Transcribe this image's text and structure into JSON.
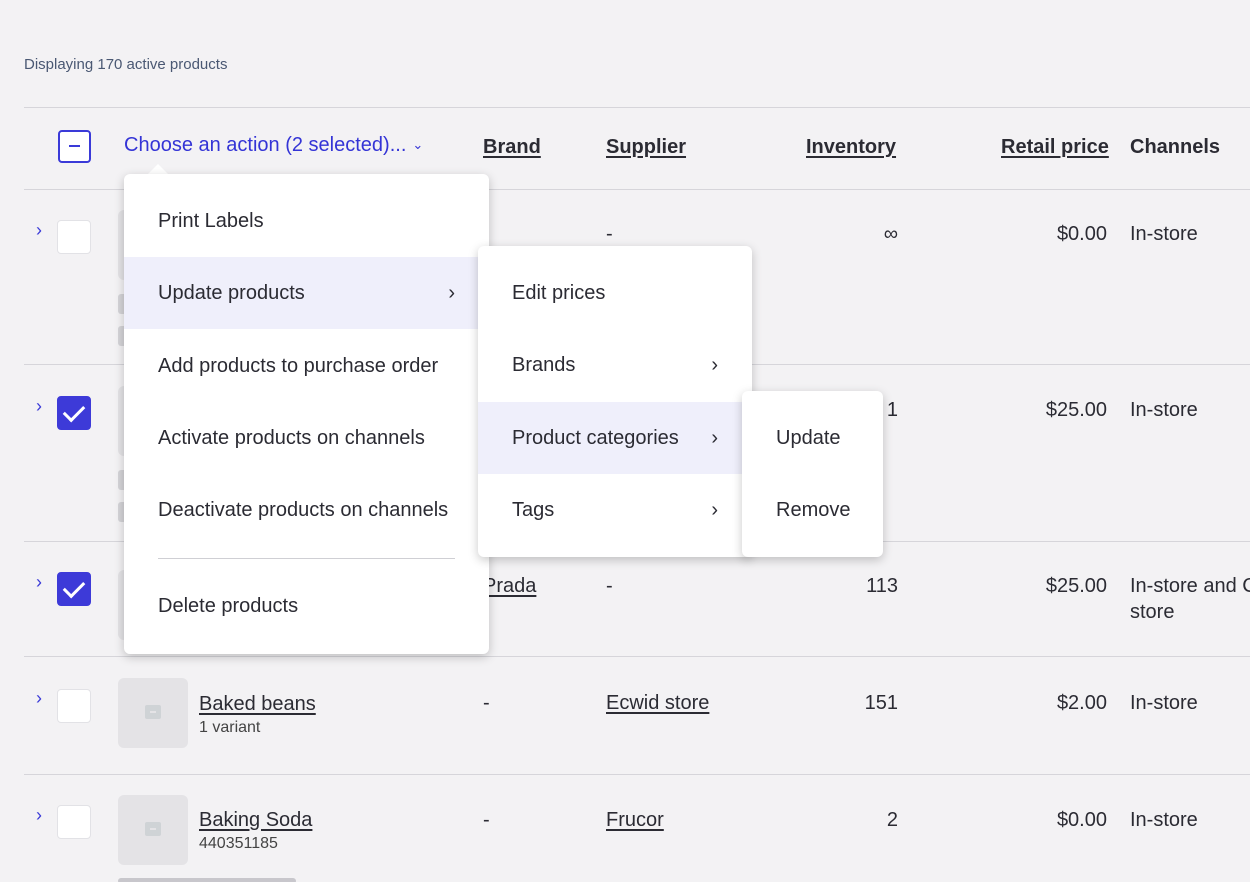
{
  "summary": "Displaying 170 active products",
  "header": {
    "action_label": "Choose an action (2 selected)...",
    "brand": "Brand",
    "supplier": "Supplier",
    "inventory": "Inventory",
    "retail_price": "Retail price",
    "channels": "Channels"
  },
  "rows": [
    {
      "name": "",
      "sub": "",
      "brand": "-",
      "supplier": "-",
      "inventory": "∞",
      "price": "$0.00",
      "channels": "In-store",
      "checked": false
    },
    {
      "name": "",
      "sub": "",
      "brand": "",
      "supplier": "",
      "inventory": "1",
      "price": "$25.00",
      "channels": "In-store",
      "checked": true
    },
    {
      "name": "",
      "sub": "",
      "brand": "Prada",
      "supplier": "-",
      "inventory": "113",
      "price": "$25.00",
      "channels": "In-store and C",
      "channels_line2": "store",
      "checked": true
    },
    {
      "name": "Baked beans",
      "sub": "1 variant",
      "brand": "-",
      "supplier": "Ecwid store",
      "inventory": "151",
      "price": "$2.00",
      "channels": "In-store",
      "checked": false
    },
    {
      "name": "Baking Soda",
      "sub": "440351185",
      "brand": "-",
      "supplier": "Frucor",
      "inventory": "2",
      "price": "$0.00",
      "channels": "In-store",
      "checked": false
    }
  ],
  "action_menu": {
    "items": [
      "Print Labels",
      "Update products",
      "Add products to purchase order",
      "Activate products on channels",
      "Deactivate products on channels"
    ],
    "delete": "Delete products"
  },
  "update_menu": {
    "items": [
      "Edit prices",
      "Brands",
      "Product categories",
      "Tags"
    ]
  },
  "category_menu": {
    "items": [
      "Update",
      "Remove"
    ]
  },
  "icons": {
    "expand": "chevron-right-icon",
    "dropdown": "chevron-down-icon",
    "submenu": "chevron-right-icon",
    "product_placeholder": "box-icon"
  },
  "colors": {
    "accent": "#3a3ad8",
    "background": "#f3f2f4",
    "menu_highlight": "#efeffb"
  }
}
